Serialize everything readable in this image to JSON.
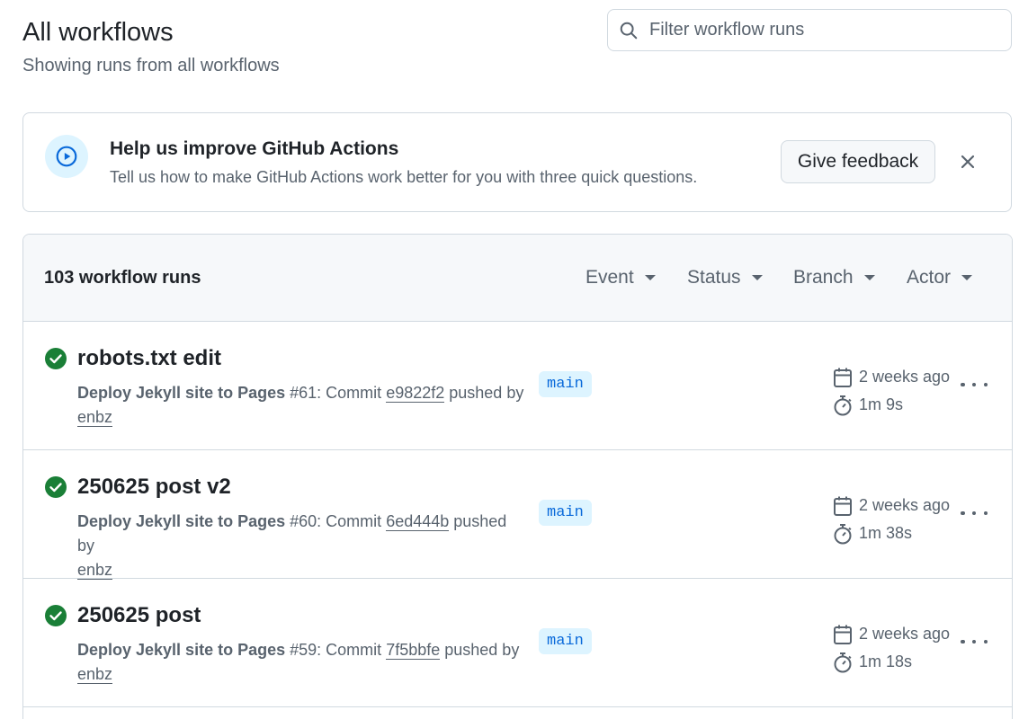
{
  "header": {
    "title": "All workflows",
    "subtitle": "Showing runs from all workflows",
    "filter_placeholder": "Filter workflow runs"
  },
  "banner": {
    "title": "Help us improve GitHub Actions",
    "text": "Tell us how to make GitHub Actions work better for you with three quick questions.",
    "button_label": "Give feedback",
    "icon": "play-circle-icon"
  },
  "runs": {
    "count_label": "103 workflow runs",
    "filters": [
      "Event",
      "Status",
      "Branch",
      "Actor"
    ],
    "items": [
      {
        "title": "robots.txt edit",
        "workflow": "Deploy Jekyll site to Pages",
        "run_number": "#61",
        "commit_prefix": ": Commit ",
        "commit": "e9822f2",
        "pushed_by": " pushed by",
        "actor": "enbz",
        "branch": "main",
        "when": "2 weeks ago",
        "duration": "1m 9s",
        "status": "success"
      },
      {
        "title": "250625 post v2",
        "workflow": "Deploy Jekyll site to Pages",
        "run_number": "#60",
        "commit_prefix": ": Commit ",
        "commit": "6ed444b",
        "pushed_by": " pushed by",
        "actor": "enbz",
        "branch": "main",
        "when": "2 weeks ago",
        "duration": "1m 38s",
        "status": "success"
      },
      {
        "title": "250625 post",
        "workflow": "Deploy Jekyll site to Pages",
        "run_number": "#59",
        "commit_prefix": ": Commit ",
        "commit": "7f5bbfe",
        "pushed_by": " pushed by",
        "actor": "enbz",
        "branch": "main",
        "when": "2 weeks ago",
        "duration": "1m 18s",
        "status": "success"
      }
    ]
  },
  "colors": {
    "success": "#1a7f37",
    "accent": "#0969da",
    "badge_bg": "#ddf4ff",
    "muted": "#59636e",
    "border": "#d1d9e0"
  }
}
